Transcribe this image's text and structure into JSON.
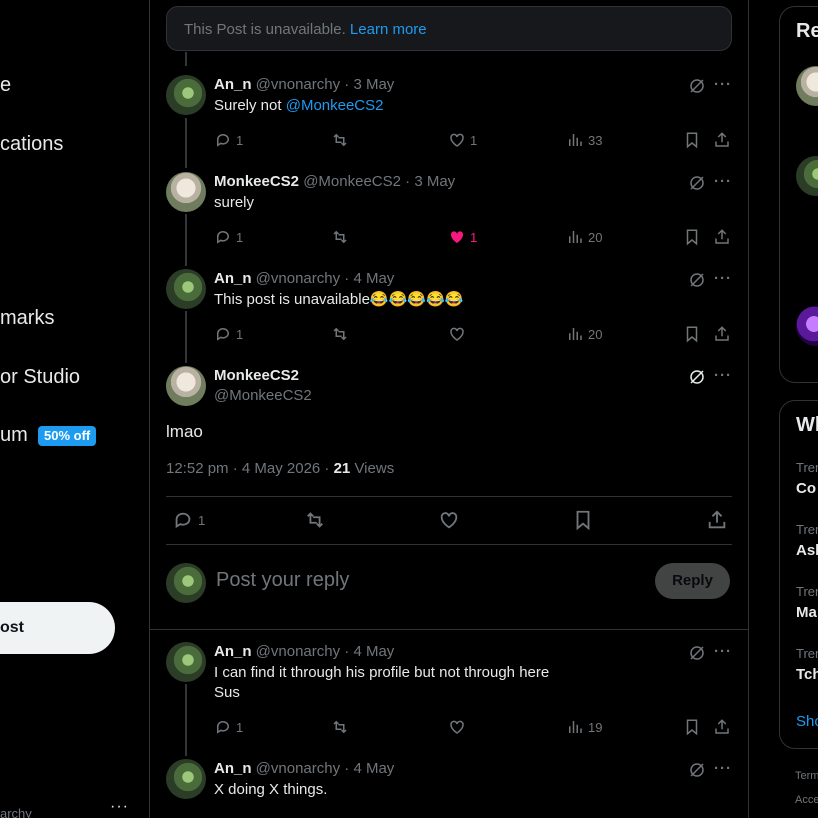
{
  "left_nav": {
    "items": [
      {
        "label": "e"
      },
      {
        "label": "cations"
      },
      {
        "label": "marks"
      },
      {
        "label": "or Studio"
      },
      {
        "label": "um"
      }
    ],
    "premium_badge": "50% off",
    "post_button": "ost",
    "account_handle_fragment": "archy",
    "account_more": "···"
  },
  "main": {
    "unavailable_notice": {
      "text": "This Post is unavailable.",
      "link": "Learn more"
    },
    "replies_top": [
      {
        "name": "An_n",
        "handle": "@vnonarchy",
        "date": "· 3 May",
        "text": "Surely not ",
        "mention": "@MonkeeCS2",
        "replies": "1",
        "reposts": "",
        "likes": "1",
        "views": "33",
        "liked": false
      },
      {
        "name": "MonkeeCS2",
        "handle": "@MonkeeCS2",
        "date": "· 3 May",
        "text": "surely",
        "mention": "",
        "replies": "1",
        "reposts": "",
        "likes": "1",
        "views": "20",
        "liked": true
      },
      {
        "name": "An_n",
        "handle": "@vnonarchy",
        "date": "· 4 May",
        "text": "This post is unavailable😂😂😂😂😂",
        "mention": "",
        "replies": "1",
        "reposts": "",
        "likes": "",
        "views": "20",
        "liked": false
      }
    ],
    "focused": {
      "name": "MonkeeCS2",
      "handle": "@MonkeeCS2",
      "text": "lmao",
      "time": "12:52 pm · 4 May 2026 · ",
      "views_count": "21",
      "views_label": " Views",
      "replies": "1"
    },
    "composer": {
      "placeholder": "Post your reply",
      "button": "Reply"
    },
    "replies_bottom": [
      {
        "name": "An_n",
        "handle": "@vnonarchy",
        "date": "· 4 May",
        "line1": "I can find it through his profile but not through here",
        "line2": "Sus",
        "replies": "1",
        "views": "19"
      },
      {
        "name": "An_n",
        "handle": "@vnonarchy",
        "date": "· 4 May",
        "line1": "X doing X things.",
        "line2": ""
      }
    ],
    "more_label": "···"
  },
  "right_sidebar": {
    "relevant_heading": "Re",
    "whats_happening_heading": "Wh",
    "trends": [
      {
        "label": "Trer",
        "title": "Co"
      },
      {
        "label": "Trer",
        "title": "Ash"
      },
      {
        "label": "Trer",
        "title": "Ma"
      },
      {
        "label": "Trer",
        "title": "Tch"
      }
    ],
    "show_more": "Sho",
    "footer": [
      "Term",
      "Acce"
    ]
  },
  "colors": {
    "background": "#000000",
    "accent": "#1d9bf0",
    "like_active": "#f91880",
    "text": "#e7e9ea",
    "muted": "#71767b",
    "border": "#2f3336"
  }
}
